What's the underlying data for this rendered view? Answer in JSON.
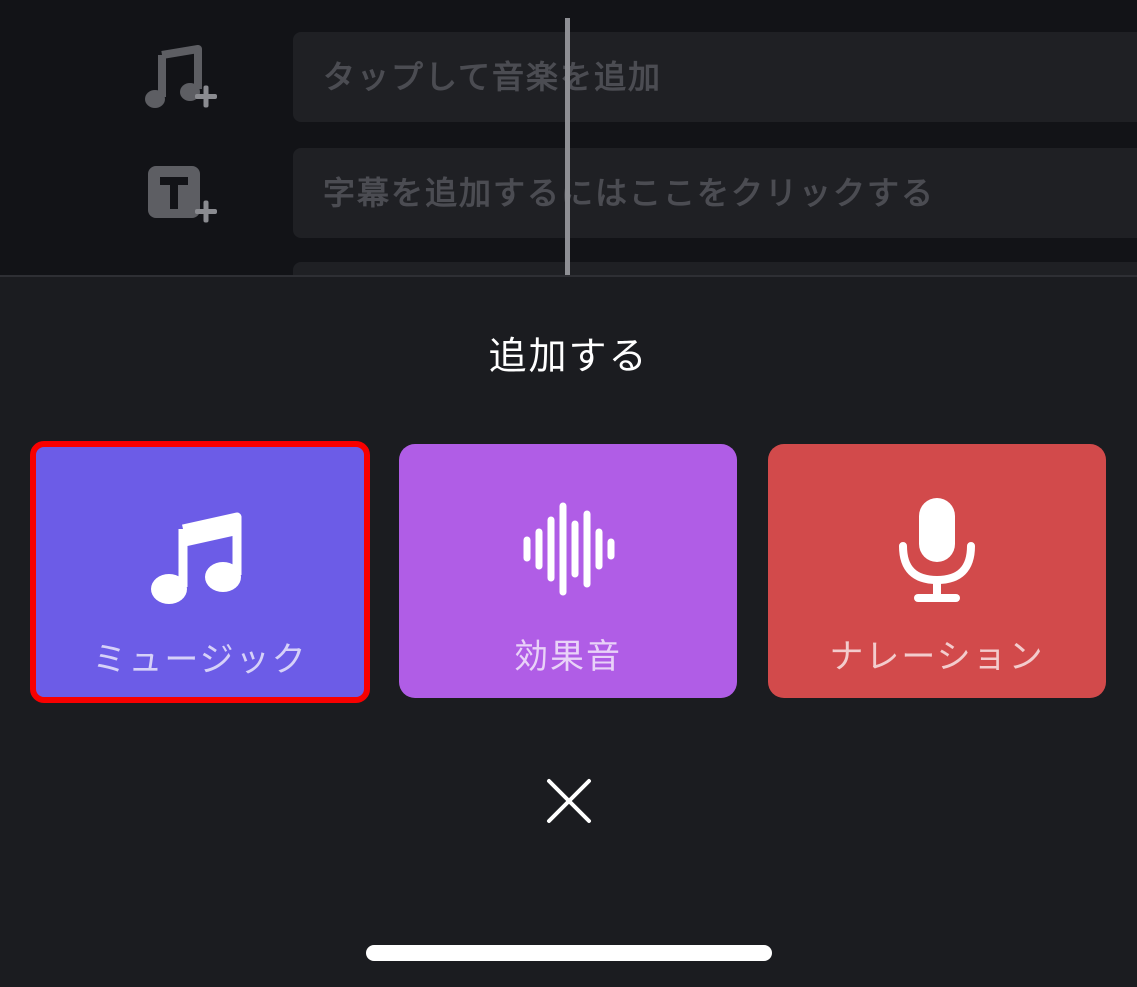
{
  "timeline": {
    "music_track": {
      "icon": "music-note-plus-icon",
      "placeholder": "タップして音楽を追加"
    },
    "caption_track": {
      "icon": "text-plus-icon",
      "placeholder": "字幕を追加するにはここをクリックする"
    }
  },
  "sheet": {
    "title": "追加する",
    "options": [
      {
        "label": "ミュージック",
        "icon": "music-note-icon",
        "color": "#6c5ce7",
        "selected": true
      },
      {
        "label": "効果音",
        "icon": "sound-wave-icon",
        "color": "#b05de6",
        "selected": false
      },
      {
        "label": "ナレーション",
        "icon": "microphone-icon",
        "color": "#d24a4b",
        "selected": false
      }
    ],
    "close_icon": "close-icon",
    "highlight_color": "#f80000"
  }
}
